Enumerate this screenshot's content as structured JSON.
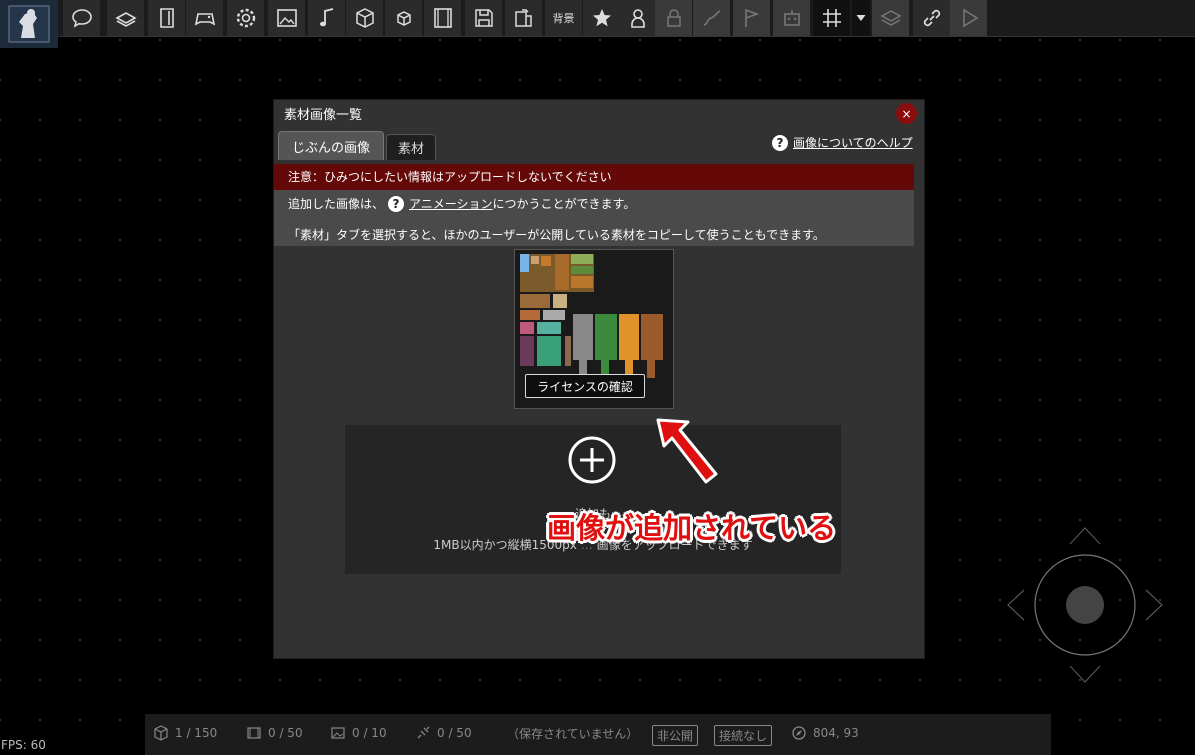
{
  "toolbar": {
    "bg_label": "背景",
    "icons": [
      "speech-bubble-icon",
      "book-icon",
      "door-icon",
      "gamepad-icon",
      "gear-icon",
      "image-icon",
      "music-note-icon",
      "cube-icon",
      "small-cube-icon",
      "film-icon",
      "save-icon",
      "export-icon",
      "background-text",
      "star-icon",
      "person-icon",
      "lock-icon",
      "path-icon",
      "flag-icon",
      "robot-icon",
      "grid-icon",
      "dropdown-arrow",
      "layers-icon",
      "link-icon",
      "play-icon"
    ]
  },
  "dialog": {
    "title": "素材画像一覧",
    "close": "×",
    "tab_mine": "じぶんの画像",
    "tab_materials": "素材",
    "help_icon": "?",
    "help_link": "画像についてのヘルプ",
    "warning": "注意：ひみつにしたい情報はアップロードしないでください",
    "info1_prefix": "追加した画像は、",
    "info1_link": "アニメーション",
    "info1_suffix": "につかうことができます。",
    "info2": "「素材」タブを選択すると、ほかのユーザーが公開している素材をコピーして使うこともできます。",
    "license_button": "ライセンスの確認",
    "upload_text1": "追加も",
    "upload_text2": "1MB以内かつ縦横1500px",
    "upload_text2_tail": "画像をアップロードできます"
  },
  "annotation": "画像が追加されている",
  "status": {
    "objects": "1 / 150",
    "scenes": "0 / 50",
    "images": "0 / 10",
    "links": "0 / 50",
    "save_status": "（保存されていません）",
    "visibility": "非公開",
    "connection": "接続なし",
    "coords": "804, 93"
  },
  "fps": "FPS: 60",
  "colors": {
    "accent_red": "#640808",
    "close_red": "#8a0e0e",
    "annotation_red": "#e01010"
  }
}
